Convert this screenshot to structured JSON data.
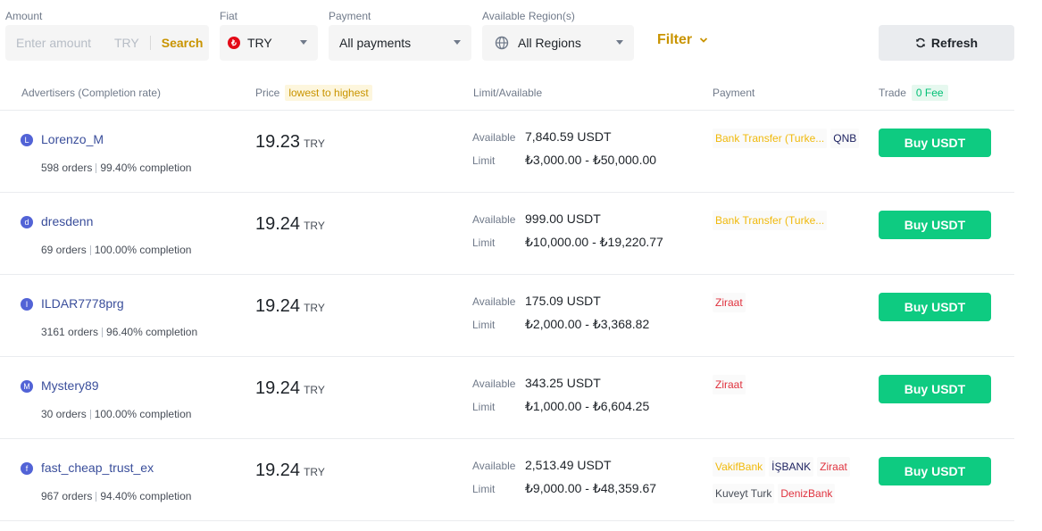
{
  "filters": {
    "amount": {
      "label": "Amount",
      "placeholder": "Enter amount",
      "currency": "TRY",
      "search_label": "Search"
    },
    "fiat": {
      "label": "Fiat",
      "value": "TRY",
      "icon": "try-flag-icon"
    },
    "payment": {
      "label": "Payment",
      "value": "All payments"
    },
    "region": {
      "label": "Available Region(s)",
      "value": "All Regions",
      "icon": "globe-icon"
    },
    "filter_label": "Filter",
    "refresh_label": "Refresh"
  },
  "table": {
    "headers": {
      "advertisers": "Advertisers (Completion rate)",
      "price": "Price",
      "price_sort": "lowest to highest",
      "limit": "Limit/Available",
      "payment": "Payment",
      "trade": "Trade",
      "trade_fee": "0 Fee"
    },
    "available_label": "Available",
    "limit_label": "Limit",
    "buy_label": "Buy USDT",
    "rows": [
      {
        "initial": "L",
        "name": "Lorenzo_M",
        "orders": "598 orders",
        "completion": "99.40% completion",
        "price": "19.23",
        "currency": "TRY",
        "available": "7,840.59 USDT",
        "limit": "₺3,000.00 - ₺50,000.00",
        "payments": [
          {
            "text": "Bank Transfer (Turke...",
            "color": "#f0b90b"
          },
          {
            "text": "QNB",
            "color": "#1e2361"
          }
        ]
      },
      {
        "initial": "d",
        "name": "dresdenn",
        "orders": "69 orders",
        "completion": "100.00% completion",
        "price": "19.24",
        "currency": "TRY",
        "available": "999.00 USDT",
        "limit": "₺10,000.00 - ₺19,220.77",
        "payments": [
          {
            "text": "Bank Transfer (Turke...",
            "color": "#f0b90b"
          }
        ]
      },
      {
        "initial": "I",
        "name": "ILDAR7778prg",
        "orders": "3161 orders",
        "completion": "96.40% completion",
        "price": "19.24",
        "currency": "TRY",
        "available": "175.09 USDT",
        "limit": "₺2,000.00 - ₺3,368.82",
        "payments": [
          {
            "text": "Ziraat",
            "color": "#e0323e"
          }
        ]
      },
      {
        "initial": "M",
        "name": "Mystery89",
        "orders": "30 orders",
        "completion": "100.00% completion",
        "price": "19.24",
        "currency": "TRY",
        "available": "343.25 USDT",
        "limit": "₺1,000.00 - ₺6,604.25",
        "payments": [
          {
            "text": "Ziraat",
            "color": "#e0323e"
          }
        ]
      },
      {
        "initial": "f",
        "name": "fast_cheap_trust_ex",
        "orders": "967 orders",
        "completion": "94.40% completion",
        "price": "19.24",
        "currency": "TRY",
        "available": "2,513.49 USDT",
        "limit": "₺9,000.00 - ₺48,359.67",
        "payments": [
          {
            "text": "VakifBank",
            "color": "#f0b90b"
          },
          {
            "text": "İŞBANK",
            "color": "#1e2361"
          },
          {
            "text": "Ziraat",
            "color": "#e0323e"
          },
          {
            "text": "Kuveyt Turk",
            "color": "#474d57"
          },
          {
            "text": "DenizBank",
            "color": "#e0323e"
          }
        ]
      }
    ]
  }
}
